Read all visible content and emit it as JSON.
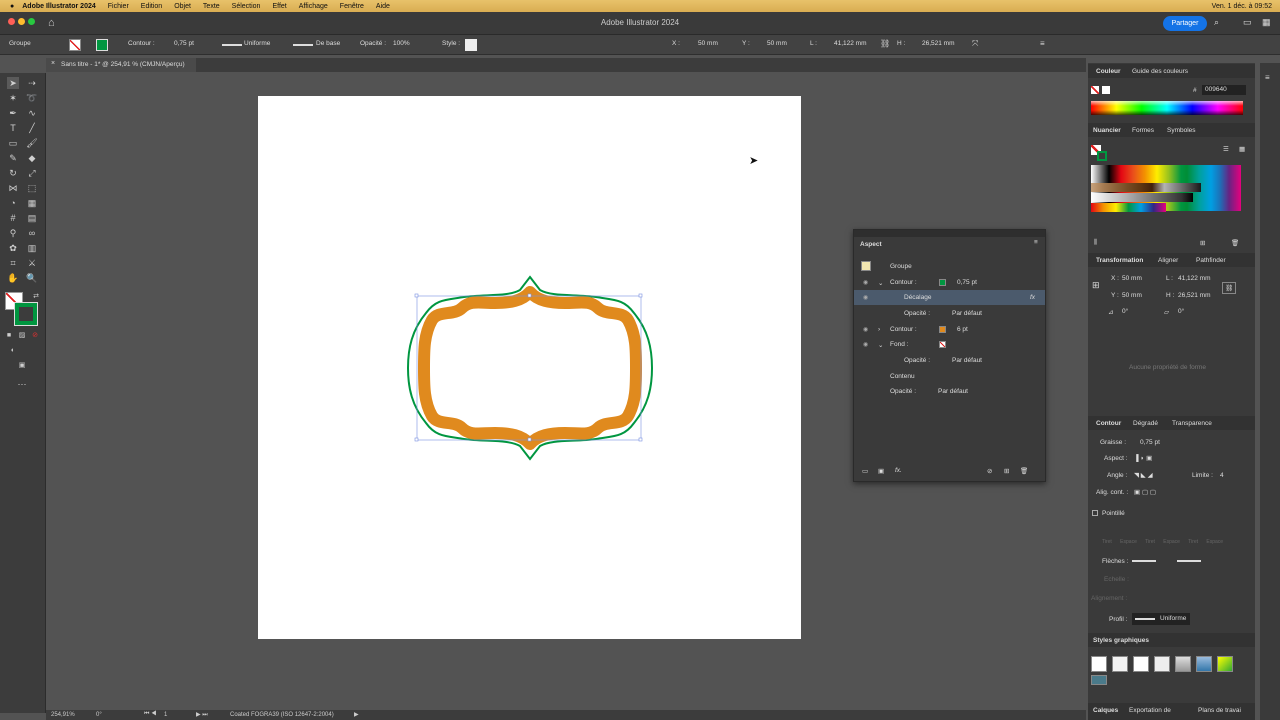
{
  "menubar": {
    "app": "Adobe Illustrator 2024",
    "items": [
      "Fichier",
      "Edition",
      "Objet",
      "Texte",
      "Sélection",
      "Effet",
      "Affichage",
      "Fenêtre",
      "Aide"
    ],
    "datetime": "Ven. 1 déc. à 09:52"
  },
  "titlebar": {
    "title": "Adobe Illustrator 2024",
    "share": "Partager"
  },
  "control": {
    "selection": "Groupe",
    "contour_label": "Contour :",
    "contour_value": "0,75 pt",
    "profile": "Uniforme",
    "brush": "De base",
    "opacity_label": "Opacité :",
    "opacity_value": "100%",
    "style_label": "Style :",
    "x_label": "X :",
    "x_value": "50 mm",
    "y_label": "Y :",
    "y_value": "50 mm",
    "l_label": "L :",
    "l_value": "41,122 mm",
    "h_label": "H :",
    "h_value": "26,521 mm"
  },
  "doc_tab": {
    "title": "Sans titre - 1* @ 254,91 % (CMJN/Aperçu)"
  },
  "status": {
    "zoom": "254,91%",
    "rotation": "0°",
    "artboard": "1",
    "profile": "Coated FOGRA39 (ISO 12647-2:2004)"
  },
  "aspect": {
    "title": "Aspect",
    "group": "Groupe",
    "rows": [
      {
        "label": "Contour :",
        "value": "0,75 pt"
      },
      {
        "label": "Décalage",
        "value": "fx"
      },
      {
        "label": "Opacité :",
        "value": "Par défaut"
      },
      {
        "label": "Contour :",
        "value": "6 pt"
      },
      {
        "label": "Fond :",
        "value": ""
      },
      {
        "label": "Opacité :",
        "value": "Par défaut"
      },
      {
        "label": "Contenu",
        "value": ""
      },
      {
        "label": "Opacité :",
        "value": "Par défaut"
      }
    ]
  },
  "right": {
    "color_tabs": [
      "Couleur",
      "Guide des couleurs"
    ],
    "hex": "009640",
    "swatch_tabs": [
      "Nuancier",
      "Formes",
      "Symboles"
    ],
    "transform_tabs": [
      "Transformation",
      "Aligner",
      "Pathfinder"
    ],
    "t_x_label": "X :",
    "t_x": "50 mm",
    "t_y_label": "Y :",
    "t_y": "50 mm",
    "t_l_label": "L :",
    "t_l": "41,122 mm",
    "t_h_label": "H :",
    "t_h": "26,521 mm",
    "t_angle": "0°",
    "t_shear": "0°",
    "no_props": "Aucune propriété de forme",
    "stroke_tabs": [
      "Contour",
      "Dégradé",
      "Transparence"
    ],
    "graisse_label": "Graisse :",
    "graisse": "0,75 pt",
    "aspect_label": "Aspect :",
    "angle_label": "Angle :",
    "limite_label": "Limite :",
    "limite": "4",
    "align_label": "Alig. cont. :",
    "pointille": "Pointillé",
    "dash_labels": [
      "Tiret",
      "Espace",
      "Tiret",
      "Espace",
      "Tiret",
      "Espace"
    ],
    "fleches": "Flèches :",
    "echelle": "Echelle :",
    "alignement": "Alignement :",
    "profil_label": "Profil :",
    "profil": "Uniforme",
    "styles_title": "Styles graphiques",
    "bottom_tabs": [
      "Calques",
      "Exportation de",
      "Plans de travai"
    ]
  },
  "colors": {
    "accent": "#1473e6",
    "stroke_green": "#009640",
    "fill_orange": "#e08a1e"
  }
}
